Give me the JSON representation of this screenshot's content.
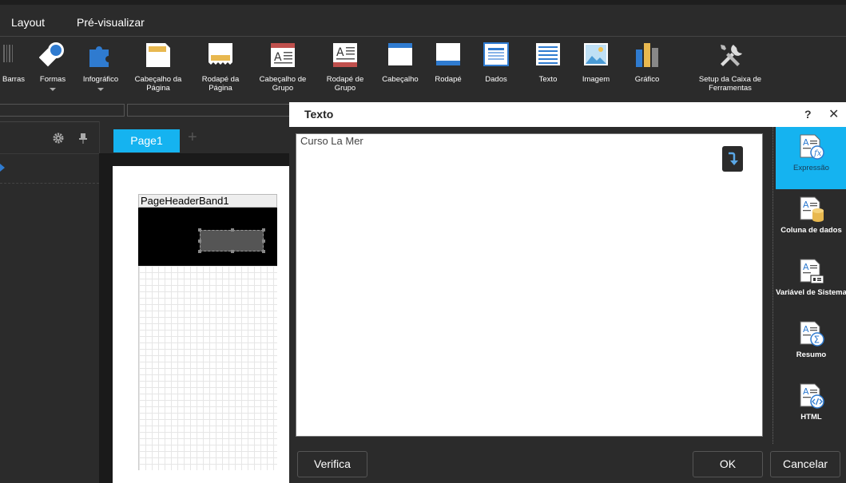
{
  "menu": {
    "layout": "Layout",
    "preview": "Pré-visualizar"
  },
  "ribbon": [
    {
      "label": "Barras",
      "icon": "barcode-icon"
    },
    {
      "label": "Formas",
      "icon": "shapes-icon"
    },
    {
      "label": "Infográfico",
      "icon": "puzzle-icon"
    },
    {
      "label": "Cabeçalho da Página",
      "icon": "page-header-icon"
    },
    {
      "label": "Rodapé da Página",
      "icon": "page-footer-icon"
    },
    {
      "label": "Cabeçalho de Grupo",
      "icon": "group-header-icon"
    },
    {
      "label": "Rodapé de Grupo",
      "icon": "group-footer-icon"
    },
    {
      "label": "Cabeçalho",
      "icon": "header-icon"
    },
    {
      "label": "Rodapé",
      "icon": "footer-icon"
    },
    {
      "label": "Dados",
      "icon": "data-icon"
    },
    {
      "label": "Texto",
      "icon": "text-icon"
    },
    {
      "label": "Imagem",
      "icon": "image-icon"
    },
    {
      "label": "Gráfico",
      "icon": "chart-icon"
    },
    {
      "label": "Setup da Caixa de Ferramentas",
      "icon": "tools-icon"
    }
  ],
  "designer": {
    "page_tab": "Page1",
    "add_tab": "+",
    "band_name": "PageHeaderBand1"
  },
  "dialog": {
    "title": "Texto",
    "help": "?",
    "close": "✕",
    "text_value": "Curso La Mer",
    "sidebar": [
      {
        "label": "Expressão",
        "icon": "expression-icon",
        "active": true
      },
      {
        "label": "Coluna de dados",
        "icon": "data-column-icon",
        "active": false
      },
      {
        "label": "Variável de Sistema",
        "icon": "system-variable-icon",
        "active": false
      },
      {
        "label": "Resumo",
        "icon": "summary-icon",
        "active": false
      },
      {
        "label": "HTML",
        "icon": "html-icon",
        "active": false
      }
    ],
    "buttons": {
      "check": "Verifica",
      "ok": "OK",
      "cancel": "Cancelar"
    }
  },
  "colors": {
    "accent": "#15b3f0",
    "background": "#2b2b2b",
    "dark": "#1a1a1a"
  }
}
